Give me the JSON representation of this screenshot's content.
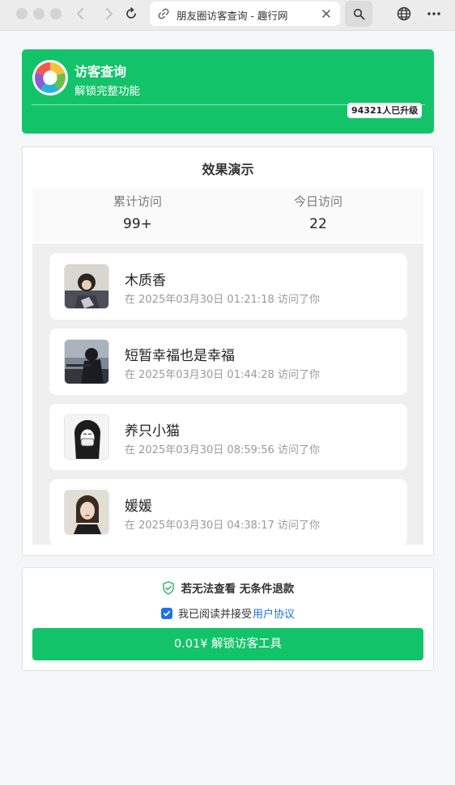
{
  "browser": {
    "tab_title": "朋友圈访客查询 - 趣行网",
    "icons": [
      "back-icon",
      "forward-icon",
      "reload-icon",
      "link-icon",
      "close-icon",
      "search-icon",
      "globe-icon",
      "more-icon"
    ]
  },
  "header": {
    "title": "访客查询",
    "subtitle": "解锁完整功能",
    "upgrade_badge": "94321人已升级",
    "accent_color": "#13c36a"
  },
  "demo": {
    "title": "效果演示",
    "stats": [
      {
        "label": "累计访问",
        "value": "99+"
      },
      {
        "label": "今日访问",
        "value": "22"
      }
    ],
    "visitors": [
      {
        "name": "木质香",
        "time": "在 2025年03月30日 01:21:18 访问了你"
      },
      {
        "name": "短暂幸福也是幸福",
        "time": "在 2025年03月30日 01:44:28 访问了你"
      },
      {
        "name": "养只小猫",
        "time": "在 2025年03月30日 08:59:56 访问了你"
      },
      {
        "name": "媛媛",
        "time": "在 2025年03月30日 04:38:17 访问了你"
      }
    ]
  },
  "pay": {
    "refund_text": "若无法查看 无条件退款",
    "agree_text": "我已阅读并接受",
    "agree_link": "用户协议",
    "agree_checked": true,
    "button_label": "0.01¥ 解锁访客工具"
  }
}
